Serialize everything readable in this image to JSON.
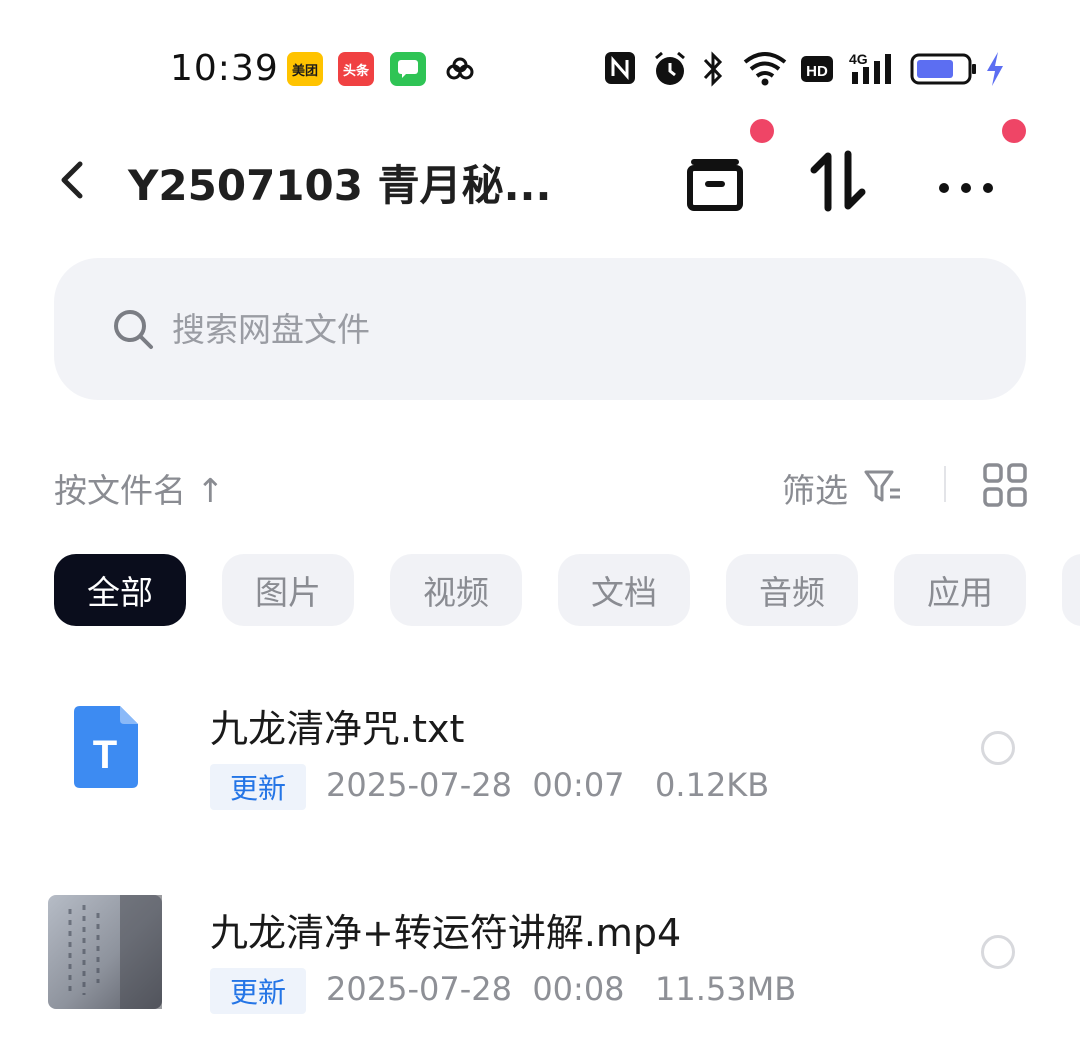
{
  "status_bar": {
    "time": "10:39",
    "meituan_label": "美团",
    "toutiao_label": "头条",
    "icons": [
      "nfc-icon",
      "alarm-icon",
      "bluetooth-icon",
      "wifi-icon",
      "hd-icon",
      "signal-4g-icon",
      "battery-icon",
      "charging-icon"
    ],
    "hd_label": "HD",
    "network_label": "4G"
  },
  "header": {
    "title": "Y2507103 青月秘...",
    "notification_color": "#ef4566"
  },
  "search": {
    "placeholder": "搜索网盘文件"
  },
  "sort_bar": {
    "sort_label": "按文件名",
    "sort_arrow": "↑",
    "filter_label": "筛选"
  },
  "categories": [
    {
      "label": "全部",
      "active": true
    },
    {
      "label": "图片",
      "active": false
    },
    {
      "label": "视频",
      "active": false
    },
    {
      "label": "文档",
      "active": false
    },
    {
      "label": "音频",
      "active": false
    },
    {
      "label": "应用",
      "active": false
    }
  ],
  "files": [
    {
      "name": "九龙清净咒.txt",
      "tag": "更新",
      "meta": "2025-07-28  00:07   0.12KB",
      "icon": "txt-file-icon",
      "icon_letter": "T"
    },
    {
      "name": "九龙清净+转运符讲解.mp4",
      "tag": "更新",
      "meta": "2025-07-28  00:08   11.53MB",
      "icon": "video-thumbnail"
    }
  ],
  "colors": {
    "accent_blue": "#2475e6",
    "active_chip": "#0a0d1c",
    "txt_icon": "#3d8bf2"
  }
}
